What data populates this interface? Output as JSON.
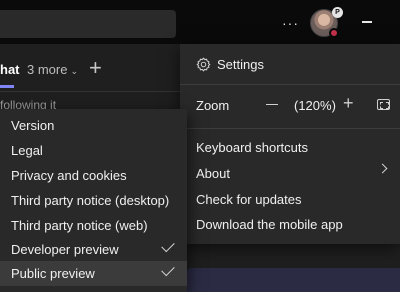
{
  "header": {
    "more_options_label": "···",
    "avatar_badge": "P"
  },
  "tabs": {
    "chat_label": "hat",
    "more_label": "3 more",
    "more_chevron": "⌄",
    "add_label": "+"
  },
  "background": {
    "partial_text": "following it"
  },
  "settings_menu": {
    "settings_label": "Settings",
    "zoom_label": "Zoom",
    "zoom_value": "(120%)",
    "zoom_plus": "+",
    "items": [
      {
        "label": "Keyboard shortcuts"
      },
      {
        "label": "About"
      },
      {
        "label": "Check for updates"
      },
      {
        "label": "Download the mobile app"
      }
    ]
  },
  "about_submenu": {
    "items": [
      {
        "label": "Version",
        "checked": false
      },
      {
        "label": "Legal",
        "checked": false
      },
      {
        "label": "Privacy and cookies",
        "checked": false
      },
      {
        "label": "Third party notice (desktop)",
        "checked": false
      },
      {
        "label": "Third party notice (web)",
        "checked": false
      },
      {
        "label": "Developer preview",
        "checked": true
      },
      {
        "label": "Public preview",
        "checked": true,
        "highlighted": true
      }
    ]
  },
  "colors": {
    "background": "#1f1f1f",
    "menu": "#292929",
    "accent": "#7f85f5",
    "status_busy": "#c4314b"
  }
}
